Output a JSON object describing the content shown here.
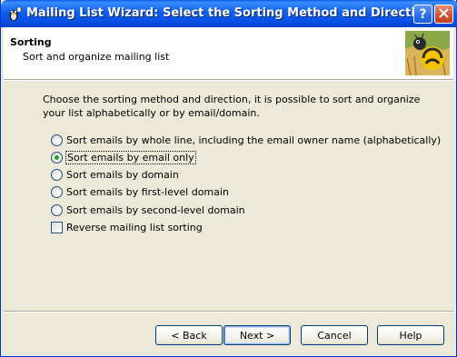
{
  "window": {
    "title": "Mailing List Wizard: Select the Sorting Method and Direction",
    "help_glyph": "?",
    "close_glyph": "✕"
  },
  "header": {
    "title": "Sorting",
    "subtitle": "Sort and organize mailing list"
  },
  "instructions": "Choose the sorting method and direction, it is possible to sort and organize your list alphabetically or by email/domain.",
  "options": [
    {
      "label": "Sort emails by whole line, including the email owner name (alphabetically)",
      "checked": false
    },
    {
      "label": "Sort emails by email only",
      "checked": true
    },
    {
      "label": "Sort emails by domain",
      "checked": false
    },
    {
      "label": "Sort emails by first-level domain",
      "checked": false
    },
    {
      "label": "Sort emails by second-level domain",
      "checked": false
    }
  ],
  "reverse": {
    "label": "Reverse mailing list sorting",
    "checked": false
  },
  "buttons": {
    "back": "< Back",
    "next": "Next >",
    "cancel": "Cancel",
    "help": "Help"
  },
  "colors": {
    "titlebar": "#0a5ce6",
    "dialog_bg": "#ece9d8",
    "radio_dot": "#21a121"
  }
}
